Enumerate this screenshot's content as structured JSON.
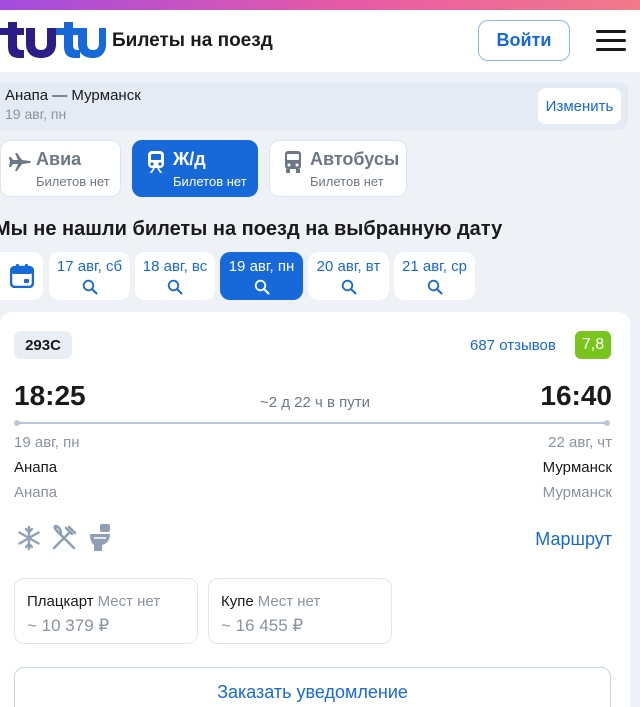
{
  "header": {
    "logo_text": "tutu",
    "title": "Билеты на поезд",
    "login_label": "Войти"
  },
  "route": {
    "text": "Анапа — Мурманск",
    "date": "19 авг, пн",
    "change_label": "Изменить"
  },
  "transport_tabs": [
    {
      "label": "Авиа",
      "sub": "Билетов нет",
      "icon": "plane-icon",
      "active": false
    },
    {
      "label": "Ж/д",
      "sub": "Билетов нет",
      "icon": "train-icon",
      "active": true
    },
    {
      "label": "Автобусы",
      "sub": "Билетов нет",
      "icon": "bus-icon",
      "active": false
    }
  ],
  "message": "Мы не нашли билеты на поезд на выбранную дату",
  "dates": [
    {
      "label": "17 авг, сб",
      "active": false
    },
    {
      "label": "18 авг, вс",
      "active": false
    },
    {
      "label": "19 авг, пн",
      "active": true
    },
    {
      "label": "20 авг, вт",
      "active": false
    },
    {
      "label": "21 авг, ср",
      "active": false
    }
  ],
  "train": {
    "number": "293С",
    "reviews": "687 отзывов",
    "rating": "7,8",
    "departure_time": "18:25",
    "arrival_time": "16:40",
    "duration": "~2 д 22 ч в пути",
    "departure_date": "19 авг, пн",
    "arrival_date": "22 авг, чт",
    "departure_city": "Анапа",
    "arrival_city": "Мурманск",
    "departure_station": "Анапа",
    "arrival_station": "Мурманск",
    "amenities": [
      "snowflake-icon",
      "fork-knife-icon",
      "toilet-icon"
    ],
    "route_link": "Маршрут",
    "classes": [
      {
        "name": "Плацкарт",
        "status": "Мест нет",
        "price": "~ 10 379 ₽"
      },
      {
        "name": "Купе",
        "status": "Мест нет",
        "price": "~ 16 455 ₽"
      }
    ],
    "notify_label": "Заказать уведомление"
  },
  "colors": {
    "accent": "#1768d9",
    "rating_green": "#7ac41e",
    "logo": "#2b1f87"
  }
}
